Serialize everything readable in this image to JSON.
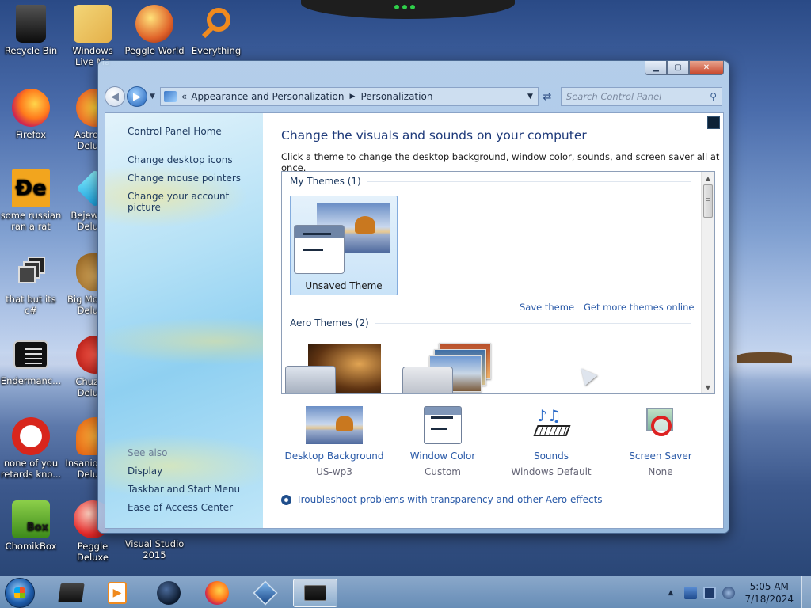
{
  "colors": {
    "accent_link": "#2a5aa8",
    "heading": "#1e3a7a",
    "taskbar": "#7fa6cf"
  },
  "desktop": {
    "icons": [
      {
        "label": "Recycle Bin",
        "icon": "recycle-bin-icon"
      },
      {
        "label": "Windows Live Ma",
        "icon": "mail-icon"
      },
      {
        "label": "Peggle World",
        "icon": "peggle-icon"
      },
      {
        "label": "Everything",
        "icon": "search-icon"
      },
      {
        "label": "Firefox",
        "icon": "firefox-icon"
      },
      {
        "label": "Astro Delu",
        "icon": "astro-icon"
      },
      {
        "label": "some russian ran a rat",
        "icon": "de-icon"
      },
      {
        "label": "Bejew Delu",
        "icon": "gem-icon"
      },
      {
        "label": "that but its c#",
        "icon": "windows-stack-icon"
      },
      {
        "label": "Big Mo Delu",
        "icon": "money-bag-icon"
      },
      {
        "label": "Endermanc...",
        "icon": "console-icon"
      },
      {
        "label": "Chuz Delu",
        "icon": "red-bird-icon"
      },
      {
        "label": "none of you retards kno...",
        "icon": "dino-icon"
      },
      {
        "label": "Insaniq Delu",
        "icon": "fish-icon"
      },
      {
        "label": "ChomikBox",
        "icon": "hamster-icon"
      },
      {
        "label": "Peggle Deluxe",
        "icon": "peggle-icon"
      },
      {
        "label": "Visual Studio 2015",
        "icon": "visual-studio-icon"
      }
    ]
  },
  "window": {
    "caption_buttons": [
      "minimize",
      "maximize",
      "close"
    ],
    "breadcrumb": {
      "overflow": "«",
      "items": [
        "Appearance and Personalization",
        "Personalization"
      ]
    },
    "search_placeholder": "Search Control Panel",
    "left_pane": {
      "links": [
        "Control Panel Home",
        "Change desktop icons",
        "Change mouse pointers",
        "Change your account picture"
      ],
      "see_also_label": "See also",
      "see_also": [
        "Display",
        "Taskbar and Start Menu",
        "Ease of Access Center"
      ]
    },
    "main": {
      "title": "Change the visuals and sounds on your computer",
      "subtitle": "Click a theme to change the desktop background, window color, sounds, and screen saver all at once.",
      "my_themes_header": "My Themes (1)",
      "my_themes": [
        {
          "name": "Unsaved Theme",
          "selected": true
        }
      ],
      "save_theme": "Save theme",
      "get_more": "Get more themes online",
      "aero_themes_header": "Aero Themes (2)",
      "settings": [
        {
          "title": "Desktop Background",
          "value": "US-wp3",
          "icon": "desktop-background-icon"
        },
        {
          "title": "Window Color",
          "value": "Custom",
          "icon": "window-color-icon"
        },
        {
          "title": "Sounds",
          "value": "Windows Default",
          "icon": "sounds-icon"
        },
        {
          "title": "Screen Saver",
          "value": "None",
          "icon": "screen-saver-icon"
        }
      ],
      "troubleshoot": "Troubleshoot problems with transparency and other Aero effects"
    }
  },
  "taskbar": {
    "pinned": [
      "terminal-icon",
      "media-player-icon",
      "obs-icon",
      "firefox-icon",
      "virtualbox-icon",
      "control-panel-icon"
    ],
    "active_index": 5,
    "clock_time": "5:05 AM",
    "clock_date": "7/18/2024"
  }
}
